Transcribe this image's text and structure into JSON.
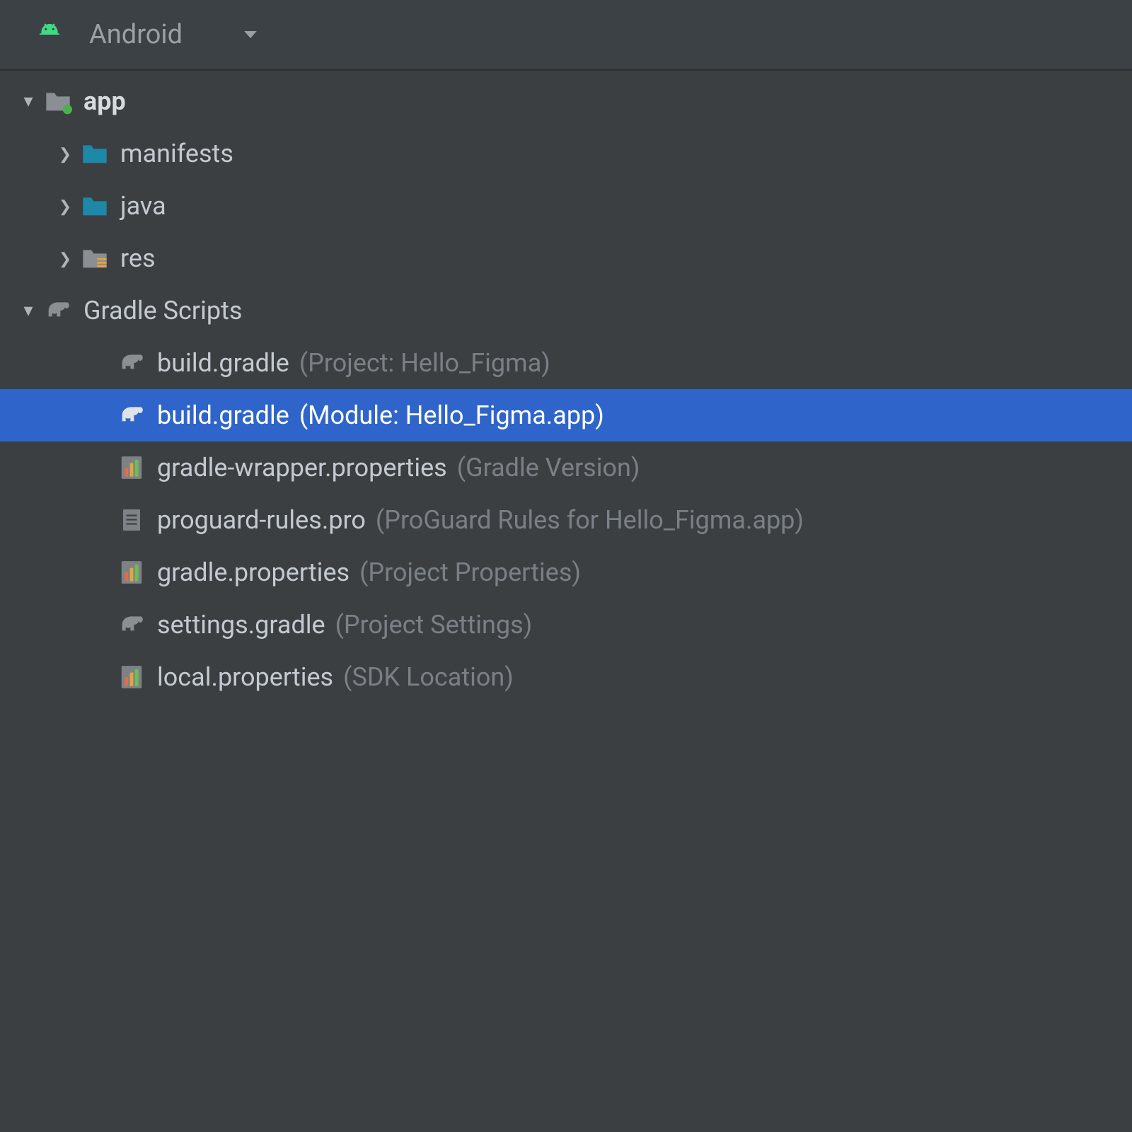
{
  "header": {
    "view_label": "Android"
  },
  "tree": {
    "app": {
      "label": "app",
      "children": {
        "manifests": {
          "label": "manifests"
        },
        "java": {
          "label": "java"
        },
        "res": {
          "label": "res"
        }
      }
    },
    "gradle_scripts": {
      "label": "Gradle Scripts",
      "items": [
        {
          "name": "build.gradle",
          "hint": "(Project: Hello_Figma)"
        },
        {
          "name": "build.gradle",
          "hint": "(Module: Hello_Figma.app)"
        },
        {
          "name": "gradle-wrapper.properties",
          "hint": "(Gradle Version)"
        },
        {
          "name": "proguard-rules.pro",
          "hint": "(ProGuard Rules for Hello_Figma.app)"
        },
        {
          "name": "gradle.properties",
          "hint": "(Project Properties)"
        },
        {
          "name": "settings.gradle",
          "hint": "(Project Settings)"
        },
        {
          "name": "local.properties",
          "hint": "(SDK Location)"
        }
      ]
    }
  }
}
